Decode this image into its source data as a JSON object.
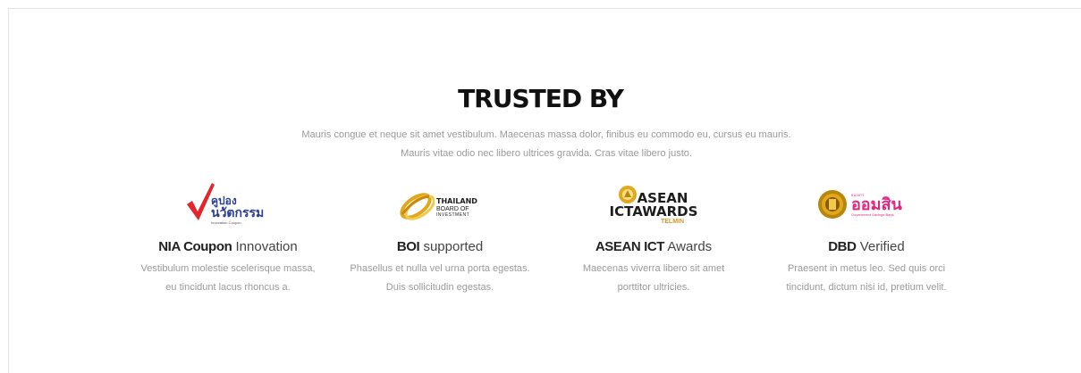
{
  "section": {
    "title": "TRUSTED BY",
    "subtitle_line1": "Mauris congue et neque sit amet vestibulum. Maecenas massa dolor, finibus eu commodo eu, cursus eu mauris.",
    "subtitle_line2": "Mauris vitae odio nec libero ultrices gravida. Cras vitae libero justo."
  },
  "cards": [
    {
      "logo_text": [
        "คูปอง",
        "นวัตกรรม",
        "Innovation Coupon"
      ],
      "title_bold": "NIA Coupon",
      "title_rest": " Innovation",
      "desc_line1": "Vestibulum molestie scelerisque massa,",
      "desc_line2": "eu tincidunt lacus rhoncus a."
    },
    {
      "logo_text": [
        "THAILAND",
        "BOARD OF",
        "INVESTMENT"
      ],
      "title_bold": "BOI",
      "title_rest": " supported",
      "desc_line1": "Phasellus et nulla vel urna porta egestas.",
      "desc_line2": "Duis sollicitudin egestas."
    },
    {
      "logo_text": [
        "ASEAN",
        "ICTAWARDS",
        "TELMIN"
      ],
      "title_bold": "ASEAN ICT",
      "title_rest": " Awards",
      "desc_line1": "Maecenas viverra libero sit amet",
      "desc_line2": "porttitor ultricies."
    },
    {
      "logo_text": [
        "ธนาคาร",
        "ออมสิน",
        "Government Savings Bank"
      ],
      "title_bold": "DBD",
      "title_rest": " Verified",
      "desc_line1": "Praesent in metus leo. Sed quis orci",
      "desc_line2": "tincidunt, dictum nisi id, pretium velit."
    }
  ],
  "colors": {
    "heading": "#111111",
    "muted_text": "#9a9a9a",
    "nia_red": "#e3262b",
    "nia_blue": "#2a3f8f",
    "boi_gold": "#e0a81c",
    "ict_gold": "#c79a2c",
    "dbd_pink": "#e0267f"
  }
}
